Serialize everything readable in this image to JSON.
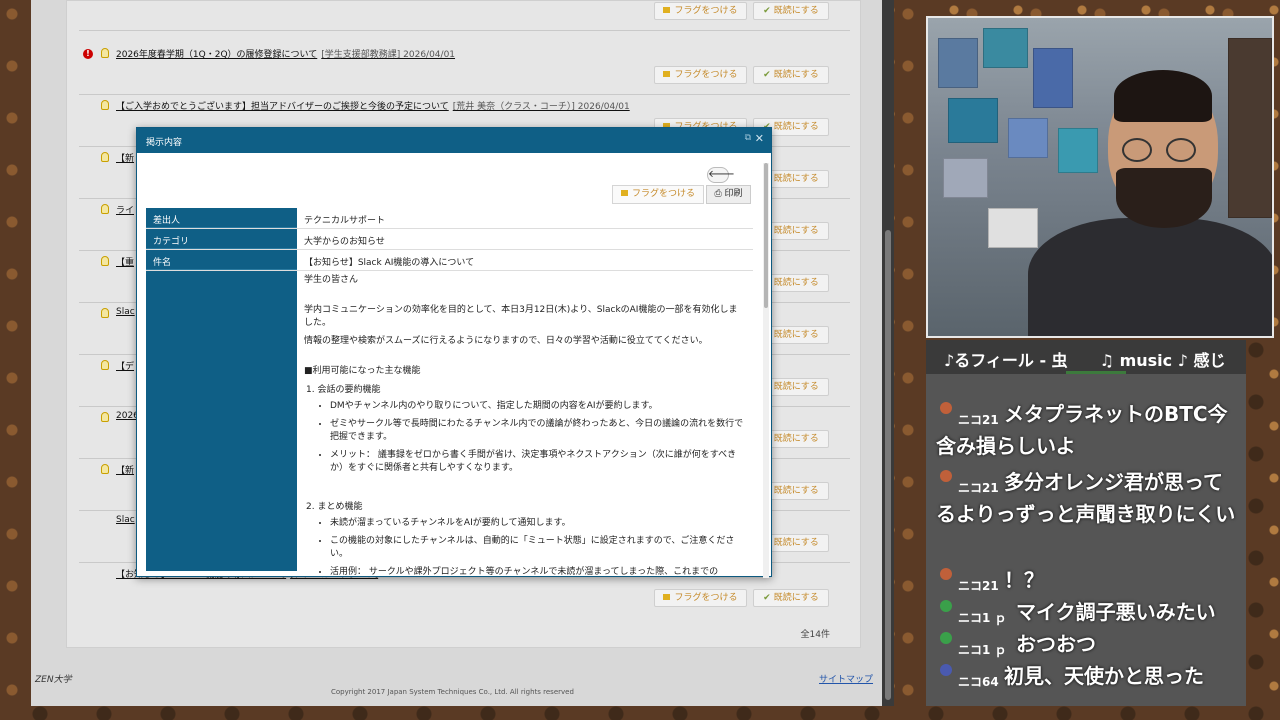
{
  "notice_list": {
    "items": [
      {
        "title": "2026年度春学期（1Q・2Q）の履修登録について",
        "meta": "[学生支援部教務課] 2026/04/01"
      },
      {
        "title": "【ご入学おめでとうございます】担当アドバイザーのご挨拶と今後の予定について",
        "meta": "[荒井 美奈（クラス・コーチ）] 2026/04/01"
      },
      {
        "title": "【新",
        "meta": ""
      },
      {
        "title": "ライ",
        "meta": ""
      },
      {
        "title": "【重",
        "meta": ""
      },
      {
        "title": "Slac",
        "meta": ""
      },
      {
        "title": "【デ",
        "meta": ""
      },
      {
        "title": "2026",
        "meta": ""
      },
      {
        "title": "【新",
        "meta": ""
      },
      {
        "title": "Slac",
        "meta": ""
      },
      {
        "title": "【お知らせ】Slack AI機能の導入について",
        "meta": "[テクニカルサポート]"
      }
    ],
    "flag_label": "フラグをつける",
    "read_label": "既読にする",
    "total": "全14件"
  },
  "footer": {
    "university": "ZEN大学",
    "sitemap": "サイトマップ",
    "copyright": "Copyright 2017 Japan System Techniques Co., Ltd. All rights reserved"
  },
  "modal": {
    "title": "掲示内容",
    "flag_label": "フラグをつける",
    "print_label": "印刷",
    "rows": [
      {
        "label": "差出人",
        "value": "テクニカルサポート"
      },
      {
        "label": "カテゴリ",
        "value": "大学からのお知らせ"
      },
      {
        "label": "件名",
        "value": "【お知らせ】Slack AI機能の導入について"
      }
    ],
    "body": {
      "greeting": "学生の皆さん",
      "intro": "学内コミュニケーションの効率化を目的として、本日3月12日(木)より、SlackのAI機能の一部を有効化しました。",
      "intro2": "情報の整理や検索がスムーズに行えるようになりますので、日々の学習や活動に役立ててください。",
      "features_heading": "■利用可能になった主な機能",
      "section1_title": "1. 会話の要約機能",
      "section1_items": [
        "DMやチャンネル内のやり取りについて、指定した期間の内容をAIが要約します。",
        "ゼミやサークル等で長時間にわたるチャンネル内での議論が終わったあと、今日の議論の流れを数行で把握できます。",
        "メリット： 議事録をゼロから書く手間が省け、決定事項やネクストアクション（次に誰が何をすべきか）をすぐに関係者と共有しやすくなります。"
      ],
      "section2_title": "2. まとめ機能",
      "section2_items": [
        "未読が溜まっているチャンネルをAIが要約して通知します。",
        "この機能の対象にしたチャンネルは、自動的に「ミュート状態」に設定されますので、ご注意ください。",
        "活用例： サークルや課外プロジェクト等のチャンネルで未読が溜まってしまった際、これまでの"
      ]
    }
  },
  "stream": {
    "now_playing": "♪るフィール - 虫　　♫ music ♪ 感じ",
    "chat": [
      {
        "user": "ニコ21",
        "text": "メタプラネットのBTC今含み損らしいよ",
        "avatar_color": "#c0603a"
      },
      {
        "user": "ニコ21",
        "text": "多分オレンジ君が思ってるよりっずっと声聞き取りにくい",
        "avatar_color": "#c0603a"
      },
      {
        "user": "ニコ21",
        "text": "！？",
        "avatar_color": "#c0603a"
      },
      {
        "user": "ニコ1 ｐ",
        "text": "マイク調子悪いみたい",
        "avatar_color": "#3aa04a"
      },
      {
        "user": "ニコ1 ｐ",
        "text": "おつおつ",
        "avatar_color": "#3aa04a"
      },
      {
        "user": "ニコ64",
        "text": "初見、天使かと思った",
        "avatar_color": "#4a5ab0"
      }
    ]
  }
}
